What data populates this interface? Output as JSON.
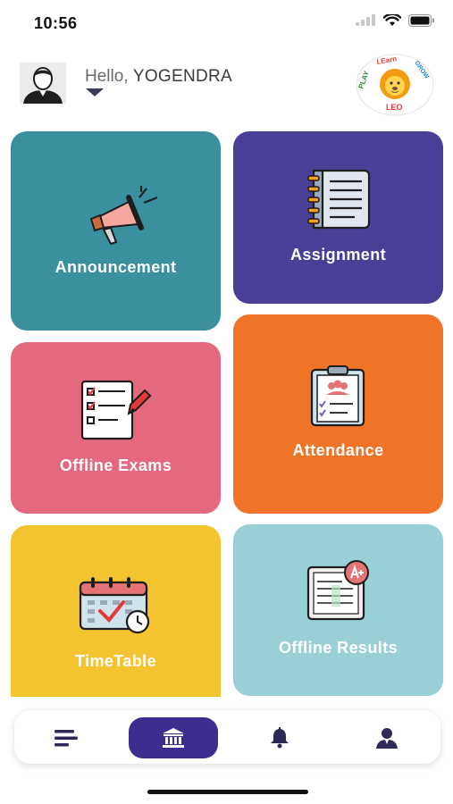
{
  "status_bar": {
    "time": "10:56"
  },
  "header": {
    "greeting_prefix": "Hello,",
    "user_name": "YOGENDRA",
    "logo_text_play": "PLAY",
    "logo_text_learn": "LEarn",
    "logo_text_grow": "GROW",
    "logo_text_leo": "LEO"
  },
  "tiles": [
    {
      "label": "Announcement",
      "icon": "megaphone-icon",
      "color": "#3a909e"
    },
    {
      "label": "Assignment",
      "icon": "notebook-icon",
      "color": "#4a3f96"
    },
    {
      "label": "Offline Exams",
      "icon": "exam-paper-icon",
      "color": "#e4697f"
    },
    {
      "label": "Attendance",
      "icon": "clipboard-icon",
      "color": "#ef7428"
    },
    {
      "label": "TimeTable",
      "icon": "calendar-icon",
      "color": "#f4c430"
    },
    {
      "label": "Offline Results",
      "icon": "result-sheet-icon",
      "color": "#99d0d6"
    }
  ],
  "bottom_nav": {
    "items": [
      {
        "name": "menu",
        "icon": "menu-icon"
      },
      {
        "name": "home",
        "icon": "institution-icon",
        "active": true
      },
      {
        "name": "notifications",
        "icon": "bell-icon"
      },
      {
        "name": "profile",
        "icon": "person-icon"
      }
    ]
  }
}
